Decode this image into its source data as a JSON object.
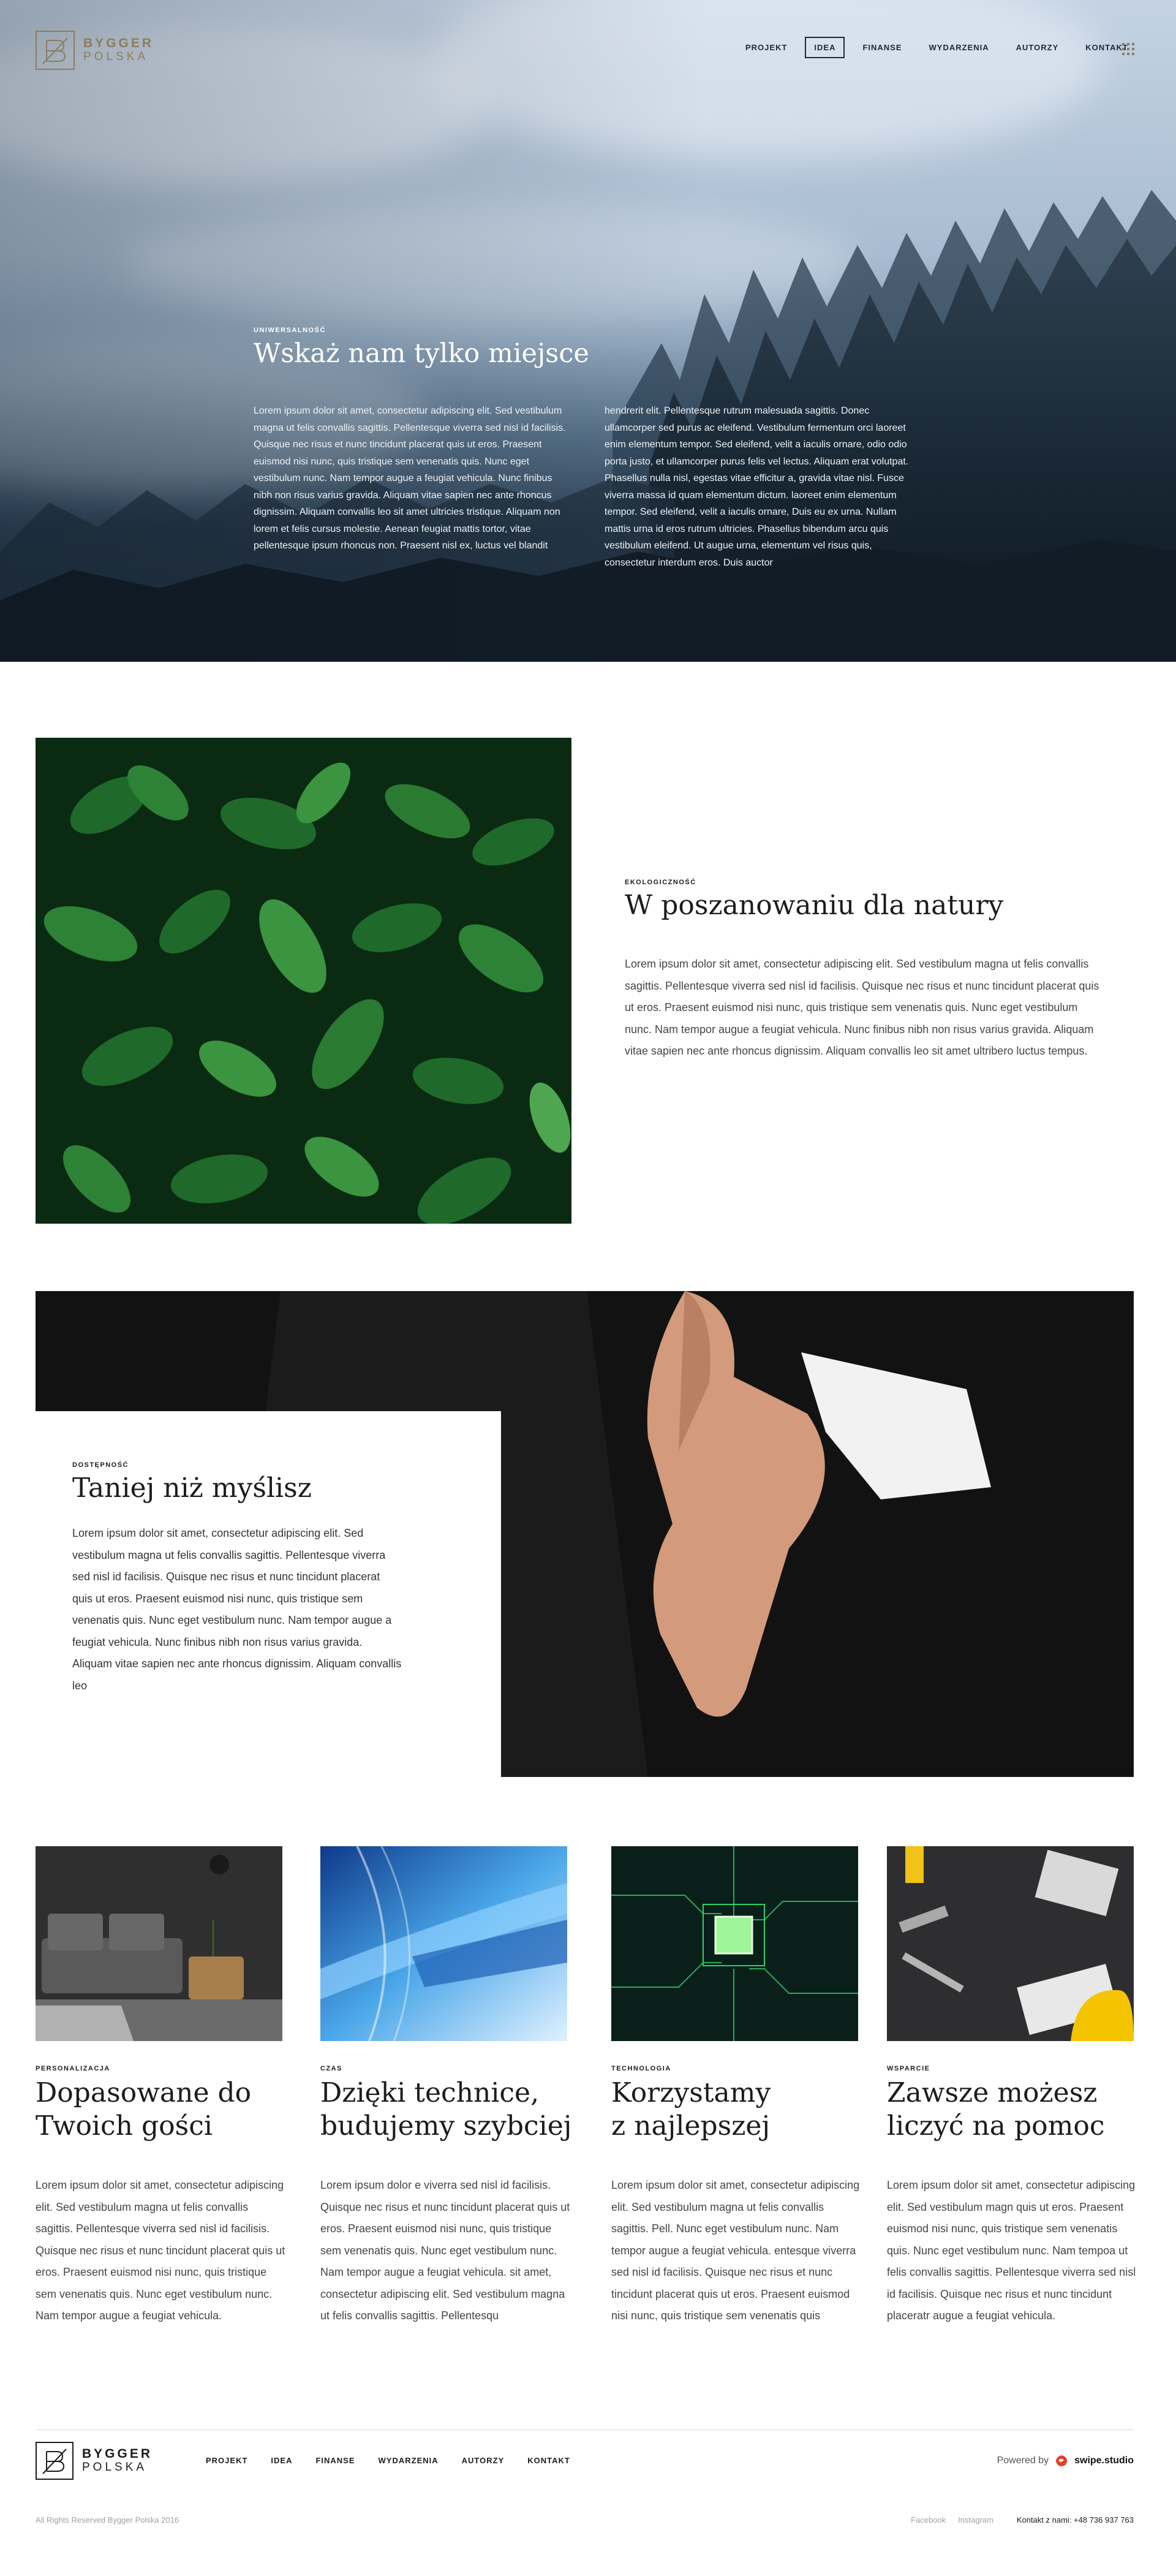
{
  "brand": {
    "name": "BYGGER",
    "sub": "POLSKA"
  },
  "nav": {
    "items": [
      "PROJEKT",
      "IDEA",
      "FINANSE",
      "WYDARZENIA",
      "AUTORZY",
      "KONTAKT"
    ],
    "active": "IDEA"
  },
  "hero": {
    "eyebrow": "UNIWERSALNOŚĆ",
    "title": "Wskaż nam tylko miejsce",
    "col1": "Lorem ipsum dolor sit amet, consectetur adipiscing elit. Sed vestibulum magna ut felis convallis sagittis. Pellentesque viverra sed nisl id facilisis. Quisque nec risus et nunc tincidunt placerat quis ut eros. Praesent euismod nisi nunc, quis tristique sem venenatis quis. Nunc eget vestibulum nunc. Nam tempor augue a feugiat vehicula. Nunc finibus nibh non risus varius gravida. Aliquam vitae sapien nec ante rhoncus dignissim. Aliquam convallis leo sit amet ultricies tristique. Aliquam non lorem et felis cursus molestie. Aenean feugiat mattis tortor, vitae pellentesque ipsum rhoncus non. Praesent nisl ex, luctus vel blandit",
    "col2": "hendrerit elit. Pellentesque rutrum malesuada sagittis. Donec ullamcorper sed purus ac eleifend. Vestibulum fermentum orci laoreet enim elementum tempor. Sed eleifend, velit a iaculis ornare, odio odio porta justo, et ullamcorper purus felis vel lectus. Aliquam erat volutpat. Phasellus nulla nisl, egestas vitae efficitur a, gravida vitae nisl. Fusce viverra massa id quam elementum dictum. laoreet enim elementum tempor. Sed eleifend, velit a iaculis ornare, Duis eu ex urna. Nullam mattis urna id eros rutrum ultricies. Phasellus bibendum arcu quis vestibulum eleifend. Ut augue urna, elementum vel risus quis, consectetur interdum eros. Duis auctor"
  },
  "nature": {
    "eyebrow": "EKOLOGICZNOŚĆ",
    "title": "W poszanowaniu dla natury",
    "text": "Lorem ipsum dolor sit amet, consectetur adipiscing elit. Sed vestibulum magna ut felis convallis sagittis. Pellentesque viverra sed nisl id facilisis. Quisque nec risus et nunc tincidunt placerat quis ut eros. Praesent euismod nisi nunc, quis tristique sem venenatis quis. Nunc eget vestibulum nunc. Nam tempor augue a feugiat vehicula. Nunc finibus nibh non risus varius gravida. Aliquam vitae sapien nec ante rhoncus dignissim. Aliquam convallis leo sit amet ultribero luctus tempus."
  },
  "price": {
    "eyebrow": "DOSTĘPNOŚĆ",
    "title": "Taniej niż myślisz",
    "text": "Lorem ipsum dolor sit amet, consectetur adipiscing elit. Sed vestibulum magna ut felis convallis sagittis. Pellentesque viverra sed nisl id facilisis. Quisque nec risus et nunc tincidunt placerat quis ut eros. Praesent euismod nisi nunc, quis tristique sem venenatis quis. Nunc eget vestibulum nunc. Nam tempor augue a feugiat vehicula. Nunc finibus nibh non risus varius gravida. Aliquam vitae sapien nec ante rhoncus dignissim. Aliquam convallis leo"
  },
  "features": [
    {
      "eyebrow": "PERSONALIZACJA",
      "title_1": "Dopasowane do",
      "title_2": "Twoich gości",
      "text": "Lorem ipsum dolor sit amet, consectetur adipiscing elit. Sed vestibulum magna ut felis convallis sagittis. Pellentesque viverra sed nisl id facilisis. Quisque nec risus et nunc tincidunt placerat quis ut eros. Praesent euismod nisi nunc, quis tristique sem venenatis quis. Nunc eget vestibulum nunc. Nam tempor augue a feugiat vehicula."
    },
    {
      "eyebrow": "CZAS",
      "title_1": "Dzięki technice,",
      "title_2": "budujemy szybciej",
      "text": "Lorem ipsum dolor e viverra sed nisl id facilisis. Quisque nec risus et nunc tincidunt placerat quis ut eros. Praesent euismod nisi nunc, quis tristique sem venenatis quis. Nunc eget vestibulum nunc. Nam tempor augue a feugiat vehicula. sit amet, consectetur adipiscing elit. Sed vestibulum magna ut felis convallis sagittis. Pellentesqu"
    },
    {
      "eyebrow": "TECHNOLOGIA",
      "title_1": "Korzystamy",
      "title_2": "z najlepszej",
      "text": "Lorem ipsum dolor sit amet, consectetur adipiscing elit. Sed vestibulum magna ut felis convallis sagittis. Pell. Nunc eget vestibulum nunc. Nam tempor augue a feugiat vehicula. entesque viverra sed nisl id facilisis. Quisque nec risus et nunc tincidunt placerat quis ut eros. Praesent euismod nisi nunc, quis tristique sem venenatis quis"
    },
    {
      "eyebrow": "WSPARCIE",
      "title_1": "Zawsze możesz",
      "title_2": "liczyć na pomoc",
      "text": "Lorem ipsum dolor sit amet, consectetur adipiscing elit. Sed vestibulum magn quis ut eros. Praesent euismod nisi nunc, quis tristique sem venenatis quis. Nunc eget vestibulum nunc. Nam tempoa ut felis convallis sagittis. Pellentesque viverra sed nisl id facilisis. Quisque nec risus et nunc tincidunt placeratr augue a feugiat vehicula."
    }
  ],
  "footer": {
    "nav": [
      "PROJEKT",
      "IDEA",
      "FINANSE",
      "WYDARZENIA",
      "AUTORZY",
      "KONTAKT"
    ],
    "powered_label": "Powered by",
    "powered_brand": "swipe.studio",
    "copyright": "All Rights Reserved Bygger Polska 2016",
    "social": [
      "Facebook",
      "Instagram"
    ],
    "contact": "Kontakt z nami: +48 736 937 763"
  },
  "colors": {
    "accent_gold": "#8b7d5e",
    "dark": "#1c1c1c",
    "swipe_red": "#e2412a"
  }
}
